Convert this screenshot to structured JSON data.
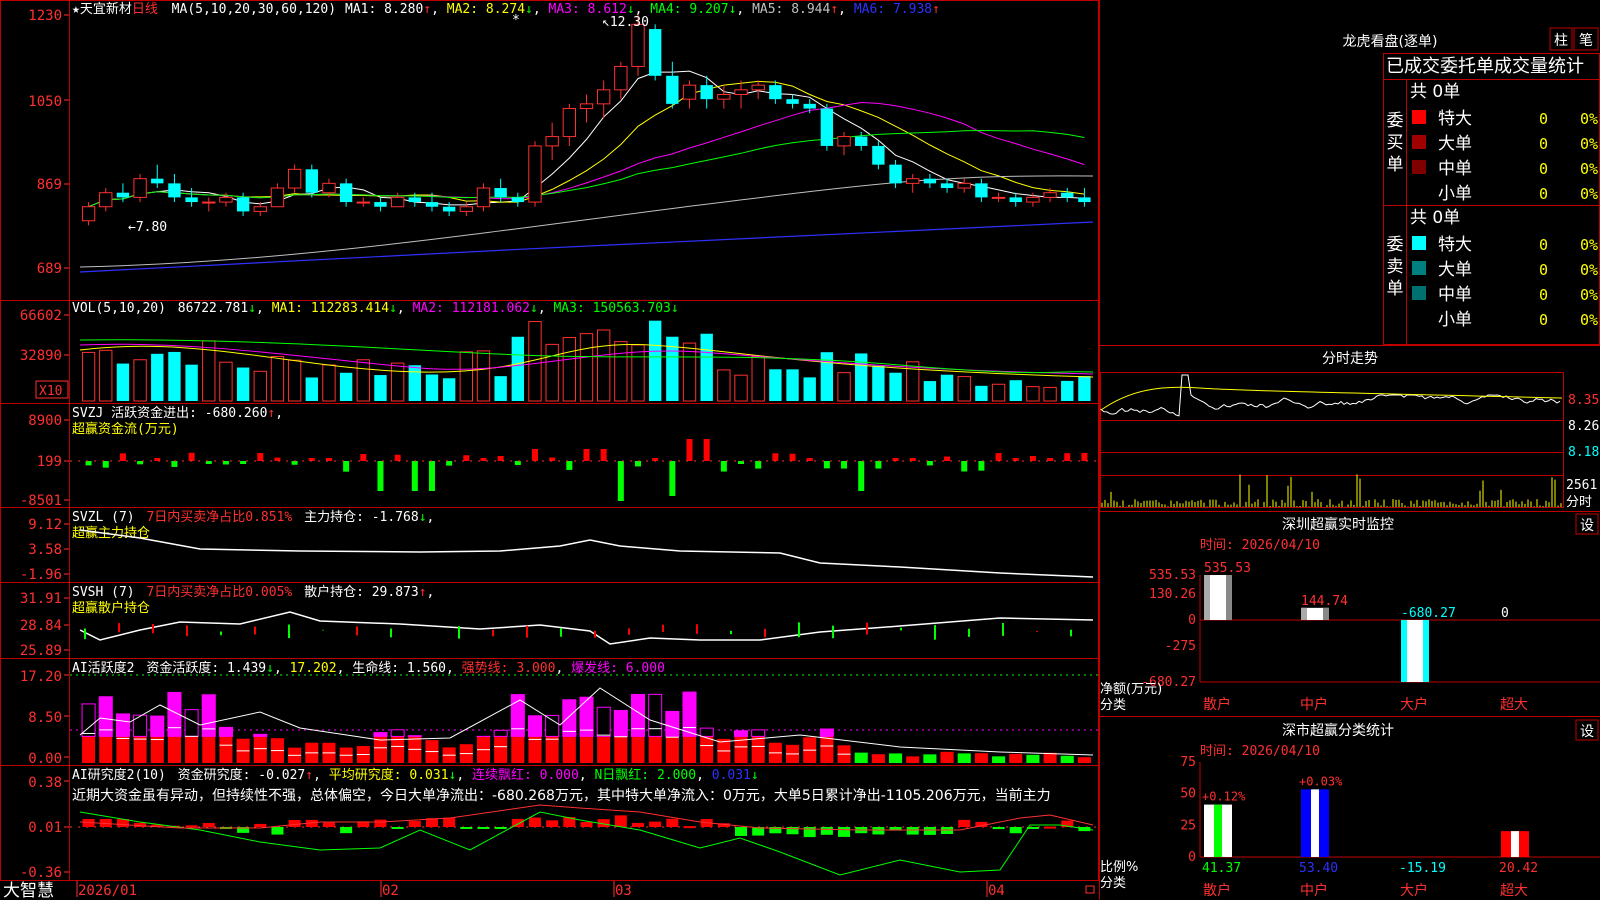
{
  "stock": {
    "name": "★天宜新材",
    "period": "日线",
    "ma_params": "MA(5,10,20,30,60,120)"
  },
  "ma_legend": [
    {
      "label": "MA1: 8.280",
      "arrow": "↑",
      "color": "#ffffff",
      "arrow_color": "#ff3030"
    },
    {
      "label": "MA2: 8.274",
      "arrow": "↓",
      "color": "#ffff00",
      "arrow_color": "#00ff00"
    },
    {
      "label": "MA3: 8.612",
      "arrow": "↓",
      "color": "#ff00ff",
      "arrow_color": "#00ff00"
    },
    {
      "label": "MA4: 9.207",
      "arrow": "↓",
      "color": "#00ff00",
      "arrow_color": "#00ff00"
    },
    {
      "label": "MA5: 8.944",
      "arrow": "↑",
      "color": "#c0c0c0",
      "arrow_color": "#ff3030"
    },
    {
      "label": "MA6: 7.938",
      "arrow": "↑",
      "color": "#3030ff",
      "arrow_color": "#ff3030"
    }
  ],
  "price_axis": [
    "1230",
    "1050",
    "869",
    "689"
  ],
  "price_annotations": {
    "high": "12.30",
    "low": "7.80"
  },
  "vol_panel": {
    "params": "VOL(5,10,20)",
    "value": "86722.781",
    "arrow": "↓",
    "ma1": "MA1: 112283.414",
    "ma1_arrow": "↓",
    "ma2": "MA2: 112181.062",
    "ma2_arrow": "↓",
    "ma3": "MA3: 150563.703",
    "ma3_arrow": "↓",
    "axis": [
      "66602",
      "32890"
    ],
    "unit": "X10"
  },
  "svzj_panel": {
    "header": "SVZJ  活跃资金进出: -680.260",
    "arrow": "↑",
    "subtitle": "超赢资金流(万元)",
    "axis": [
      "8900",
      "199",
      "-8501"
    ]
  },
  "svzl_panel": {
    "name": "SVZL (7)",
    "ratio": "7日内买卖净占比0.851%",
    "hold": "主力持仓: -1.768",
    "arrow": "↓",
    "subtitle": "超赢主力持仓",
    "axis": [
      "9.12",
      "3.58",
      "-1.96"
    ]
  },
  "svsh_panel": {
    "name": "SVSH (7)",
    "ratio": "7日内买卖净占比0.005%",
    "hold": "散户持仓: 29.873",
    "arrow": "↑",
    "subtitle": "超赢散户持仓",
    "axis": [
      "31.91",
      "28.84",
      "25.89"
    ]
  },
  "ai_active": {
    "name": "AI活跃度2",
    "active": "资金活跃度: 1.439",
    "a_arrow": "↓",
    "v2": "17.202",
    "life": "生命线: 1.560",
    "strong": "强势线: 3.000",
    "burst": "爆发线: 6.000",
    "axis": [
      "17.20",
      "8.50",
      "0.00"
    ]
  },
  "ai_research": {
    "name": "AI研究度2(10)",
    "research": "资金研究度: -0.027",
    "r_arrow": "↑",
    "avg": "平均研究度: 0.031",
    "avg_arrow": "↓",
    "red": "连续飘红: 0.000",
    "nred": "N日飘红: 2.000",
    "n2": "0.031",
    "n2_arrow": "↓",
    "text": "近期大资金虽有异动，但持续性不强，总体偏空，今日大单净流出：-680.268万元，其中特大单净流入：0万元，大单5日累计净出-1105.206万元，当前主力",
    "axis": [
      "0.38",
      "0.01",
      "-0.36"
    ]
  },
  "date_axis": [
    "2026/01",
    "02",
    "03",
    "04"
  ],
  "brand": "大智慧",
  "lhb": {
    "title": "龙虎看盘(逐单)",
    "btn1": "柱",
    "btn2": "笔",
    "header": "已成交委托单成交量统计",
    "buy": {
      "label": "委买单",
      "total": "共 0单",
      "rows": [
        {
          "name": "特大",
          "v": "0",
          "p": "0%",
          "color": "#ff0000"
        },
        {
          "name": "大单",
          "v": "0",
          "p": "0%",
          "color": "#a00000"
        },
        {
          "name": "中单",
          "v": "0",
          "p": "0%",
          "color": "#800000"
        },
        {
          "name": "小单",
          "v": "0",
          "p": "0%",
          "color": ""
        }
      ]
    },
    "sell": {
      "label": "委卖单",
      "total": "共 0单",
      "rows": [
        {
          "name": "特大",
          "v": "0",
          "p": "0%",
          "color": "#00ffff"
        },
        {
          "name": "大单",
          "v": "0",
          "p": "0%",
          "color": "#008080"
        },
        {
          "name": "中单",
          "v": "0",
          "p": "0%",
          "color": "#007070"
        },
        {
          "name": "小单",
          "v": "0",
          "p": "0%",
          "color": ""
        }
      ]
    }
  },
  "intraday": {
    "title": "分时走势",
    "prices": [
      "8.35",
      "8.26",
      "8.18"
    ],
    "vol": "2561",
    "vol_unit": "分时"
  },
  "sz_monitor": {
    "title": "深圳超赢实时监控",
    "btn": "设",
    "time": "时间: 2026/04/10",
    "axis": [
      "535.53",
      "130.26",
      "0",
      "-275",
      "-680.27"
    ],
    "ylabel": "净额(万元)",
    "xlabel": "分类",
    "bars": [
      {
        "cat": "散户",
        "value": 535.53,
        "label": "535.53"
      },
      {
        "cat": "中户",
        "value": 144.74,
        "label": "144.74"
      },
      {
        "cat": "大户",
        "value": -680.27,
        "label": "-680.27"
      },
      {
        "cat": "超大",
        "value": 0,
        "label": "0"
      }
    ]
  },
  "sz_stats": {
    "title": "深市超赢分类统计",
    "btn": "设",
    "time": "时间: 2026/04/10",
    "axis": [
      "75",
      "50",
      "25",
      "0"
    ],
    "ylabel": "比例%",
    "xlabel": "分类",
    "bars": [
      {
        "cat": "散户",
        "value": 41.37,
        "label": "41.37",
        "top": "+0.12%"
      },
      {
        "cat": "中户",
        "value": 53.4,
        "label": "53.40",
        "top": "+0.03%"
      },
      {
        "cat": "大户",
        "value": -15.19,
        "label": "-15.19",
        "top": ""
      },
      {
        "cat": "超大",
        "value": 20.42,
        "label": "20.42",
        "top": ""
      }
    ]
  },
  "colors": {
    "up": "#ff3030",
    "down": "#00ffff",
    "border": "#c00000"
  },
  "chart_data": {
    "type": "candlestick",
    "title": "天宜新材 日线",
    "dates": [
      "2026-01",
      "2026-02",
      "2026-03",
      "2026-04"
    ],
    "ohlc": [
      [
        7.9,
        8.3,
        7.8,
        8.2
      ],
      [
        8.2,
        8.6,
        8.1,
        8.5
      ],
      [
        8.5,
        8.7,
        8.3,
        8.4
      ],
      [
        8.4,
        8.9,
        8.3,
        8.8
      ],
      [
        8.8,
        9.1,
        8.6,
        8.7
      ],
      [
        8.7,
        8.9,
        8.3,
        8.4
      ],
      [
        8.4,
        8.6,
        8.2,
        8.3
      ],
      [
        8.3,
        8.4,
        8.1,
        8.3
      ],
      [
        8.3,
        8.5,
        8.2,
        8.4
      ],
      [
        8.4,
        8.5,
        8.0,
        8.1
      ],
      [
        8.1,
        8.3,
        8.0,
        8.2
      ],
      [
        8.2,
        8.7,
        8.2,
        8.6
      ],
      [
        8.6,
        9.1,
        8.5,
        9.0
      ],
      [
        9.0,
        9.1,
        8.4,
        8.5
      ],
      [
        8.5,
        8.8,
        8.4,
        8.7
      ],
      [
        8.7,
        8.8,
        8.2,
        8.3
      ],
      [
        8.3,
        8.4,
        8.2,
        8.3
      ],
      [
        8.3,
        8.4,
        8.1,
        8.2
      ],
      [
        8.2,
        8.5,
        8.2,
        8.4
      ],
      [
        8.4,
        8.5,
        8.2,
        8.3
      ],
      [
        8.3,
        8.5,
        8.1,
        8.2
      ],
      [
        8.2,
        8.3,
        8.0,
        8.1
      ],
      [
        8.1,
        8.3,
        8.0,
        8.2
      ],
      [
        8.2,
        8.7,
        8.1,
        8.6
      ],
      [
        8.6,
        8.8,
        8.3,
        8.4
      ],
      [
        8.4,
        8.5,
        8.2,
        8.3
      ],
      [
        8.3,
        9.6,
        8.2,
        9.5
      ],
      [
        9.5,
        10.0,
        9.2,
        9.7
      ],
      [
        9.7,
        10.4,
        9.5,
        10.3
      ],
      [
        10.3,
        10.6,
        10.0,
        10.4
      ],
      [
        10.4,
        10.9,
        10.1,
        10.7
      ],
      [
        10.7,
        11.3,
        10.5,
        11.2
      ],
      [
        11.2,
        12.3,
        11.0,
        12.1
      ],
      [
        12.0,
        12.1,
        10.9,
        11.0
      ],
      [
        11.0,
        11.3,
        10.3,
        10.4
      ],
      [
        10.5,
        10.9,
        10.3,
        10.8
      ],
      [
        10.8,
        11.0,
        10.3,
        10.5
      ],
      [
        10.5,
        10.8,
        10.3,
        10.6
      ],
      [
        10.6,
        10.9,
        10.3,
        10.7
      ],
      [
        10.7,
        10.9,
        10.5,
        10.8
      ],
      [
        10.8,
        10.9,
        10.4,
        10.5
      ],
      [
        10.5,
        10.6,
        10.3,
        10.4
      ],
      [
        10.4,
        10.5,
        10.2,
        10.3
      ],
      [
        10.3,
        10.4,
        9.4,
        9.5
      ],
      [
        9.5,
        9.8,
        9.3,
        9.7
      ],
      [
        9.7,
        9.8,
        9.4,
        9.5
      ],
      [
        9.5,
        9.6,
        9.0,
        9.1
      ],
      [
        9.1,
        9.2,
        8.6,
        8.7
      ],
      [
        8.7,
        8.9,
        8.5,
        8.8
      ],
      [
        8.8,
        8.9,
        8.6,
        8.7
      ],
      [
        8.7,
        8.8,
        8.5,
        8.6
      ],
      [
        8.6,
        8.8,
        8.5,
        8.7
      ],
      [
        8.7,
        8.8,
        8.3,
        8.4
      ],
      [
        8.4,
        8.5,
        8.3,
        8.4
      ],
      [
        8.4,
        8.5,
        8.2,
        8.3
      ],
      [
        8.3,
        8.5,
        8.2,
        8.4
      ],
      [
        8.4,
        8.6,
        8.3,
        8.5
      ],
      [
        8.5,
        8.6,
        8.3,
        8.4
      ],
      [
        8.4,
        8.6,
        8.2,
        8.3
      ]
    ]
  }
}
